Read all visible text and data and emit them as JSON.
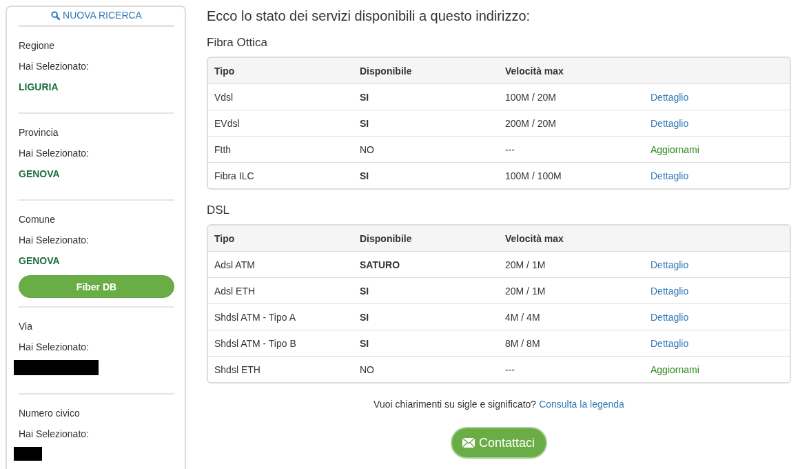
{
  "sidebar": {
    "new_search": "NUOVA RICERCA",
    "sections": [
      {
        "label": "Regione",
        "prompt": "Hai Selezionato:",
        "value": "LIGURIA",
        "redacted": false
      },
      {
        "label": "Provincia",
        "prompt": "Hai Selezionato:",
        "value": "GENOVA",
        "redacted": false
      },
      {
        "label": "Comune",
        "prompt": "Hai Selezionato:",
        "value": "GENOVA",
        "redacted": false,
        "button": "Fiber DB"
      },
      {
        "label": "Via",
        "prompt": "Hai Selezionato:",
        "redacted": true,
        "kind": "long"
      },
      {
        "label": "Numero civico",
        "prompt": "Hai Selezionato:",
        "redacted": true,
        "kind": "short"
      }
    ]
  },
  "heading": "Ecco lo stato dei servizi disponibili a questo indirizzo:",
  "tables": [
    {
      "title": "Fibra Ottica",
      "columns": [
        "Tipo",
        "Disponibile",
        "Velocità max"
      ],
      "rows": [
        {
          "type": "Vdsl",
          "available_text": "SI",
          "available": true,
          "speed": "100M / 20M",
          "action": "Dettaglio",
          "kind": "detail"
        },
        {
          "type": "EVdsl",
          "available_text": "SI",
          "available": true,
          "speed": "200M / 20M",
          "action": "Dettaglio",
          "kind": "detail"
        },
        {
          "type": "Ftth",
          "available_text": "NO",
          "available": false,
          "speed": "---",
          "action": "Aggiornami",
          "kind": "update"
        },
        {
          "type": "Fibra ILC",
          "available_text": "SI",
          "available": true,
          "speed": "100M / 100M",
          "action": "Dettaglio",
          "kind": "detail"
        }
      ]
    },
    {
      "title": "DSL",
      "columns": [
        "Tipo",
        "Disponibile",
        "Velocità max"
      ],
      "rows": [
        {
          "type": "Adsl ATM",
          "available_text": "SATURO",
          "available": true,
          "speed": "20M / 1M",
          "action": "Dettaglio",
          "kind": "detail"
        },
        {
          "type": "Adsl ETH",
          "available_text": "SI",
          "available": true,
          "speed": "20M / 1M",
          "action": "Dettaglio",
          "kind": "detail"
        },
        {
          "type": "Shdsl ATM - Tipo A",
          "available_text": "SI",
          "available": true,
          "speed": "4M / 4M",
          "action": "Dettaglio",
          "kind": "detail"
        },
        {
          "type": "Shdsl ATM - Tipo B",
          "available_text": "SI",
          "available": true,
          "speed": "8M / 8M",
          "action": "Dettaglio",
          "kind": "detail"
        },
        {
          "type": "Shdsl ETH",
          "available_text": "NO",
          "available": false,
          "speed": "---",
          "action": "Aggiornami",
          "kind": "update"
        }
      ]
    }
  ],
  "legend": {
    "question": "Vuoi chiarimenti su sigle e significato?",
    "link": "Consulta la legenda"
  },
  "contact_button": "Contattaci"
}
